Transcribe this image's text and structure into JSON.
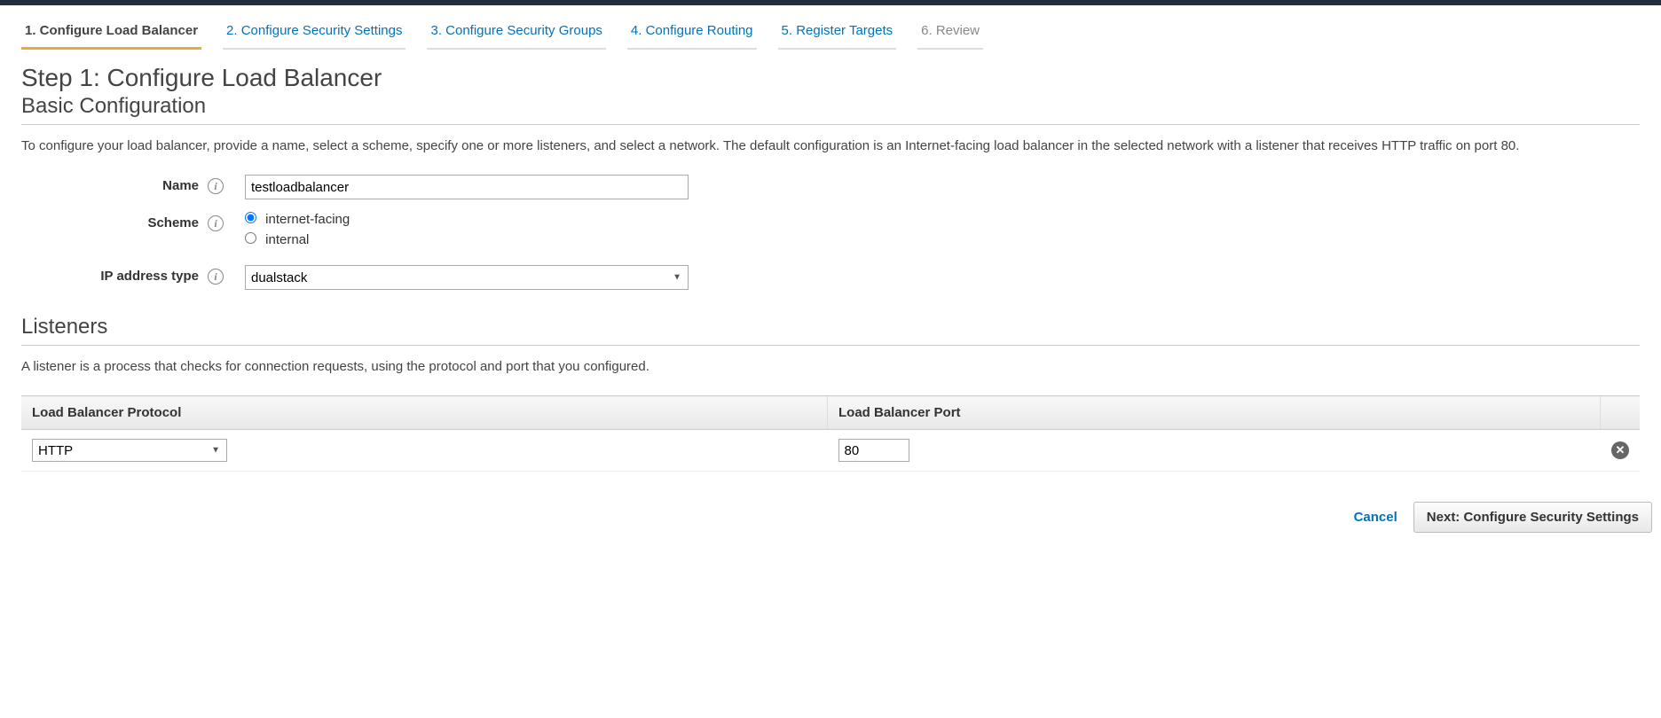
{
  "wizard": {
    "steps": [
      {
        "label": "1. Configure Load Balancer",
        "state": "active"
      },
      {
        "label": "2. Configure Security Settings",
        "state": "link"
      },
      {
        "label": "3. Configure Security Groups",
        "state": "link"
      },
      {
        "label": "4. Configure Routing",
        "state": "link"
      },
      {
        "label": "5. Register Targets",
        "state": "link"
      },
      {
        "label": "6. Review",
        "state": "disabled"
      }
    ]
  },
  "step_title": "Step 1: Configure Load Balancer",
  "basic": {
    "section_title": "Basic Configuration",
    "description": "To configure your load balancer, provide a name, select a scheme, specify one or more listeners, and select a network. The default configuration is an Internet-facing load balancer in the selected network with a listener that receives HTTP traffic on port 80.",
    "name_label": "Name",
    "name_value": "testloadbalancer",
    "scheme_label": "Scheme",
    "scheme_options": {
      "internet_facing": "internet-facing",
      "internal": "internal"
    },
    "scheme_selected": "internet-facing",
    "ip_type_label": "IP address type",
    "ip_type_value": "dualstack"
  },
  "listeners": {
    "section_title": "Listeners",
    "description": "A listener is a process that checks for connection requests, using the protocol and port that you configured.",
    "col_protocol": "Load Balancer Protocol",
    "col_port": "Load Balancer Port",
    "rows": [
      {
        "protocol": "HTTP",
        "port": "80"
      }
    ]
  },
  "footer": {
    "cancel": "Cancel",
    "next": "Next: Configure Security Settings"
  }
}
